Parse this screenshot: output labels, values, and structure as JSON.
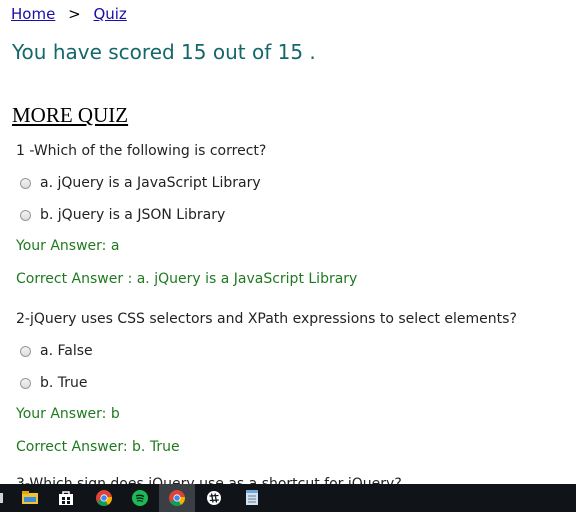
{
  "breadcrumb": {
    "home": "Home",
    "separator": ">",
    "current": "Quiz"
  },
  "score_text": "You have scored 15 out of 15 .",
  "more_quiz_heading": "MORE QUIZ",
  "questions": [
    {
      "text": "1 -Which of the following is correct?",
      "options": [
        "a. jQuery is a JavaScript Library",
        "b. jQuery is a JSON Library"
      ],
      "your_answer": "Your Answer: a",
      "correct_answer": "Correct Answer : a. jQuery is a JavaScript Library"
    },
    {
      "text": "2-jQuery uses CSS selectors and XPath expressions to select elements?",
      "options": [
        "a. False",
        "b. True"
      ],
      "your_answer": "Your Answer: b",
      "correct_answer": "Correct Answer: b. True"
    }
  ],
  "cut_off_question": "3-Which sign does jQuery use as a shortcut for jQuery?",
  "colors": {
    "score": "#16676c",
    "answer_green": "#1f7a1f",
    "link": "#1a0dab",
    "taskbar": "#101419"
  },
  "taskbar": {
    "icons": [
      "file-explorer-icon",
      "store-icon",
      "chrome-icon",
      "spotify-icon",
      "chrome-icon",
      "slack-icon",
      "notepad-icon"
    ],
    "active_index": 4
  }
}
